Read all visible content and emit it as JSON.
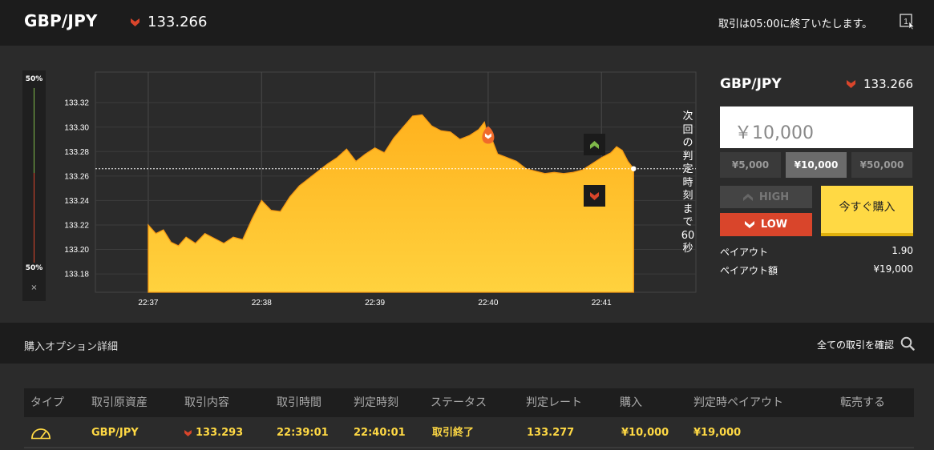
{
  "header": {
    "pair": "GBP/JPY",
    "rate": "133.266",
    "message": "取引は05:00に終了いたします。",
    "counter": "1"
  },
  "ratio": {
    "high_pct": "50%",
    "low_pct": "50%",
    "close": "×"
  },
  "countdown": "次回の判定時刻まで60秒",
  "trade": {
    "pair": "GBP/JPY",
    "rate": "133.266",
    "amount": "￥10,000",
    "chips": [
      "¥5,000",
      "¥10,000",
      "¥50,000"
    ],
    "active_chip": 1,
    "high_label": "HIGH",
    "low_label": "LOW",
    "buy_label": "今すぐ購入",
    "payout_label": "ペイアウト",
    "payout_value": "1.90",
    "payout_amount_label": "ペイアウト額",
    "payout_amount_value": "¥19,000"
  },
  "details": {
    "title": "購入オプション詳細",
    "link": "全ての取引を確認"
  },
  "table": {
    "headers": [
      "タイプ",
      "取引原資産",
      "取引内容",
      "取引時間",
      "判定時刻",
      "ステータス",
      "判定レート",
      "購入",
      "判定時ペイアウト",
      "転売する"
    ],
    "row": {
      "asset": "GBP/JPY",
      "content": "133.293",
      "time": "22:39:01",
      "judge_time": "22:40:01",
      "status": "取引終了",
      "judge_rate": "133.277",
      "purchase": "¥10,000",
      "payout": "¥19,000"
    }
  },
  "colors": {
    "accent": "#ffd944",
    "low": "#d9452b",
    "high": "#7fb84a",
    "area": "#ffc433"
  },
  "chart_data": {
    "type": "area",
    "x_ticks": [
      "22:37",
      "22:38",
      "22:39",
      "22:40",
      "22:41"
    ],
    "y_ticks": [
      "133.32",
      "133.30",
      "133.28",
      "133.26",
      "133.24",
      "133.22",
      "133.20",
      "133.18"
    ],
    "ylim": [
      133.165,
      133.345
    ],
    "xlim_sec": [
      -28,
      290
    ],
    "current_rate": 133.266,
    "entry": {
      "t": 180,
      "v": 133.293
    },
    "x": [
      0,
      4,
      8,
      12,
      16,
      20,
      25,
      30,
      35,
      40,
      45,
      50,
      55,
      60,
      65,
      70,
      75,
      80,
      85,
      90,
      95,
      100,
      105,
      110,
      115,
      120,
      125,
      130,
      135,
      140,
      145,
      150,
      155,
      160,
      165,
      170,
      175,
      178,
      180,
      182,
      185,
      190,
      195,
      200,
      205,
      210,
      215,
      220,
      225,
      230,
      235,
      240,
      245,
      248,
      251,
      254,
      257
    ],
    "values": [
      133.22,
      133.213,
      133.216,
      133.206,
      133.203,
      133.21,
      133.205,
      133.213,
      133.209,
      133.205,
      133.21,
      133.208,
      133.225,
      133.24,
      133.232,
      133.231,
      133.243,
      133.252,
      133.258,
      133.264,
      133.27,
      133.275,
      133.282,
      133.272,
      133.278,
      133.283,
      133.279,
      133.291,
      133.3,
      133.309,
      133.31,
      133.301,
      133.297,
      133.296,
      133.29,
      133.293,
      133.298,
      133.304,
      133.291,
      133.29,
      133.278,
      133.275,
      133.272,
      133.266,
      133.264,
      133.262,
      133.263,
      133.262,
      133.263,
      133.265,
      133.27,
      133.275,
      133.279,
      133.284,
      133.281,
      133.272,
      133.266
    ]
  }
}
